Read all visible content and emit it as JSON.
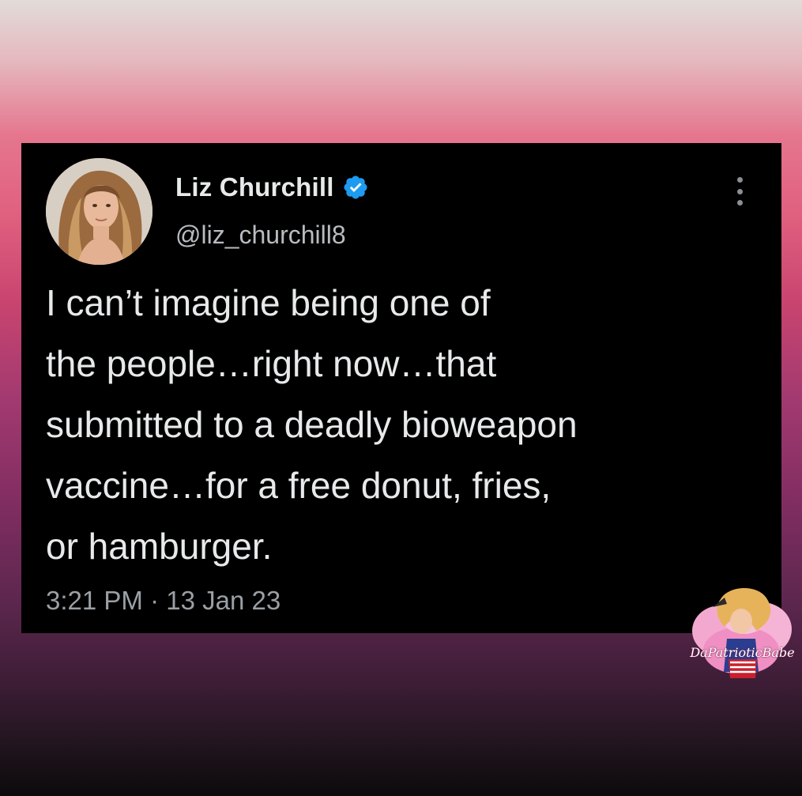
{
  "tweet": {
    "author": {
      "display_name": "Liz Churchill",
      "handle": "@liz_churchill8",
      "verified": true,
      "verified_color": "#1d9bf0"
    },
    "text": "I can’t imagine being one of\nthe people…right now…that\nsubmitted to a deadly bioweapon\nvaccine…for a free donut, fries,\nor hamburger.",
    "timestamp": "3:21 PM · 13 Jan 23"
  },
  "icons": {
    "verified": "verified-badge-icon",
    "more": "more-options-icon"
  },
  "watermark": {
    "text": "DaPatrioticBabe"
  },
  "colors": {
    "card_background": "#000000",
    "primary_text": "#e7e9ea",
    "secondary_text": "#9aa0a5"
  }
}
